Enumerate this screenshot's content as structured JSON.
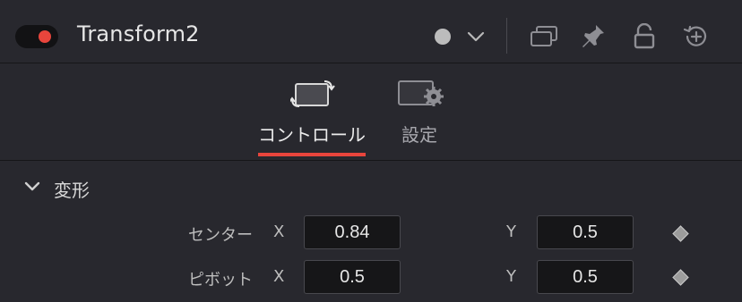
{
  "header": {
    "node_name": "Transform2",
    "enabled": true,
    "accent_color": "#e8453c",
    "icons": [
      "color-dot-icon",
      "chevron-down-icon",
      "versions-icon",
      "pin-icon",
      "lock-icon",
      "reset-icon"
    ]
  },
  "tabs": [
    {
      "label": "コントロール",
      "icon": "controls-icon",
      "active": true
    },
    {
      "label": "設定",
      "icon": "settings-icon",
      "active": false
    }
  ],
  "section": {
    "title": "変形",
    "expanded": true,
    "rows": [
      {
        "label": "センター",
        "x_label": "X",
        "x_value": "0.84",
        "y_label": "Y",
        "y_value": "0.5"
      },
      {
        "label": "ピボット",
        "x_label": "X",
        "x_value": "0.5",
        "y_label": "Y",
        "y_value": "0.5"
      }
    ]
  }
}
